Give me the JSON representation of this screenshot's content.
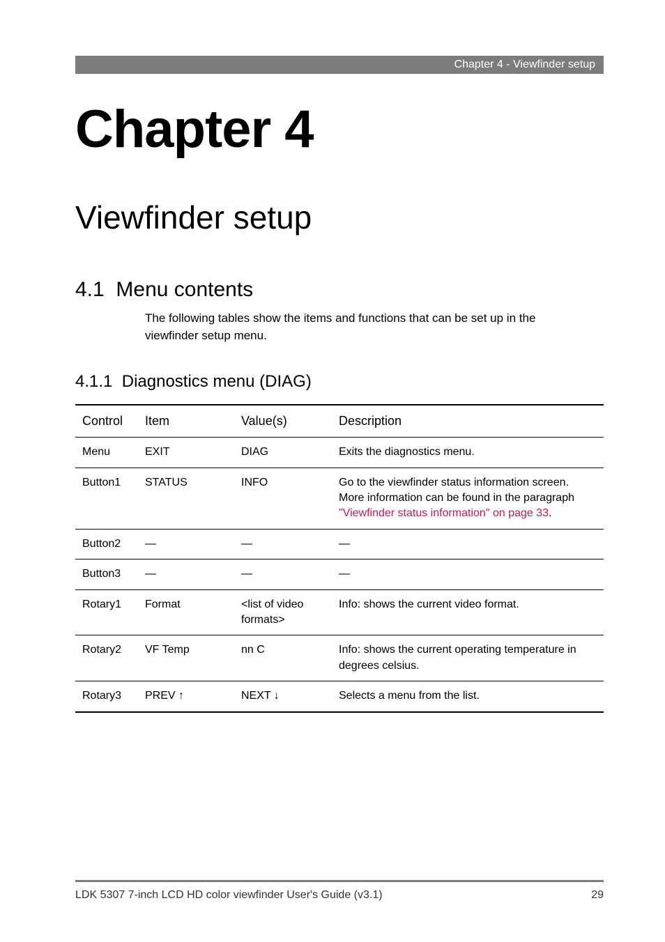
{
  "header": {
    "text": "Chapter 4 - Viewfinder setup"
  },
  "chapter": {
    "title": "Chapter 4",
    "subtitle": "Viewfinder setup"
  },
  "section": {
    "number": "4.1",
    "title": "Menu contents",
    "intro": "The following tables show the items and functions that can be set up in the viewfinder setup menu."
  },
  "subsection": {
    "number": "4.1.1",
    "title": "Diagnostics menu (DIAG)"
  },
  "table": {
    "headers": {
      "c1": "Control",
      "c2": "Item",
      "c3": "Value(s)",
      "c4": "Description"
    },
    "rows": [
      {
        "control": "Menu",
        "item": "EXIT",
        "values": "DIAG",
        "desc_pre": "Exits the diagnostics menu.",
        "link": "",
        "desc_post": ""
      },
      {
        "control": "Button1",
        "item": "STATUS",
        "values": "INFO",
        "desc_pre": "Go to the viewfinder status information screen. More information can be found in the paragraph ",
        "link": "\"Viewfinder status information\" on page 33",
        "desc_post": "."
      },
      {
        "control": "Button2",
        "item": "—",
        "values": "—",
        "desc_pre": "—",
        "link": "",
        "desc_post": ""
      },
      {
        "control": "Button3",
        "item": "—",
        "values": "—",
        "desc_pre": "—",
        "link": "",
        "desc_post": ""
      },
      {
        "control": "Rotary1",
        "item": "Format",
        "values": "<list of video formats>",
        "desc_pre": "Info: shows the current video format.",
        "link": "",
        "desc_post": ""
      },
      {
        "control": "Rotary2",
        "item": "VF Temp",
        "values": "nn C",
        "desc_pre": "Info: shows the current operating temperature in degrees celsius.",
        "link": "",
        "desc_post": ""
      },
      {
        "control": "Rotary3",
        "item": "PREV ↑",
        "values": "NEXT ↓",
        "desc_pre": "Selects a menu from the list.",
        "link": "",
        "desc_post": ""
      }
    ]
  },
  "footer": {
    "title": "LDK 5307 7-inch LCD HD color viewfinder User's Guide (v3.1)",
    "page": "29"
  }
}
